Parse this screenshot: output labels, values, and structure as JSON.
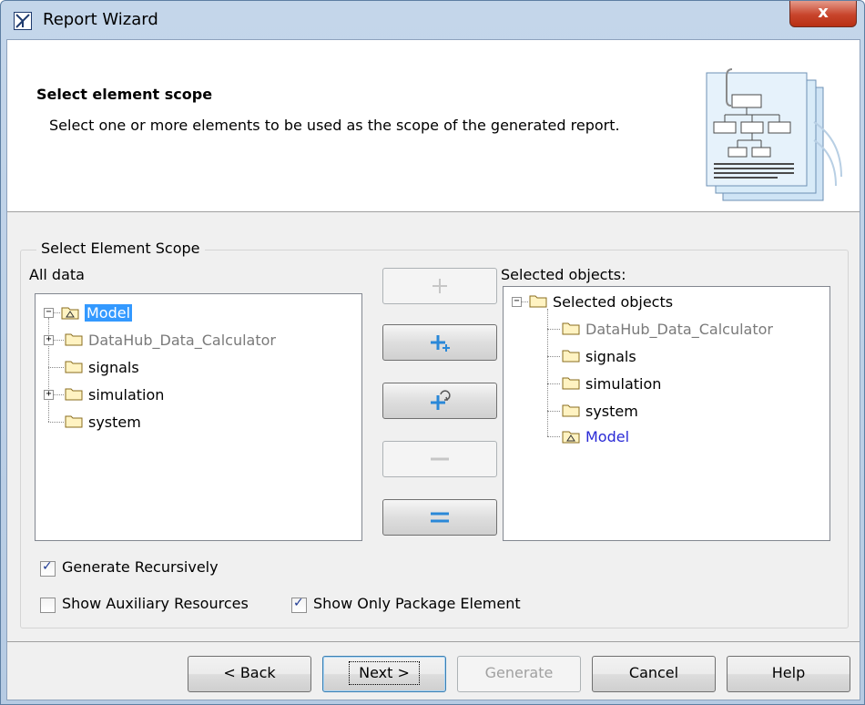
{
  "window": {
    "title": "Report Wizard",
    "close_label": "x"
  },
  "header": {
    "title": "Select element scope",
    "description": "Select one or more elements to be used as the scope of the generated report."
  },
  "scope": {
    "group_title": "Select Element Scope",
    "all_data_label": "All data",
    "selected_label": "Selected objects:",
    "left_tree": {
      "root": "Model",
      "children": [
        "DataHub_Data_Calculator",
        "signals",
        "simulation",
        "system"
      ]
    },
    "right_tree": {
      "root": "Selected objects",
      "children": [
        "DataHub_Data_Calculator",
        "signals",
        "simulation",
        "system",
        "Model"
      ]
    }
  },
  "options": {
    "generate_recursively": {
      "label": "Generate Recursively",
      "checked": true
    },
    "show_auxiliary": {
      "label": "Show Auxiliary Resources",
      "checked": false
    },
    "show_only_package": {
      "label": "Show Only Package Element",
      "checked": true
    }
  },
  "buttons": {
    "back": "< Back",
    "next": "Next >",
    "generate": "Generate",
    "cancel": "Cancel",
    "help": "Help"
  },
  "colors": {
    "selection": "#3399ff",
    "link_blue": "#2929d6",
    "disabled_gray": "#7a7a7a",
    "accent_blue": "#2a88d8"
  }
}
